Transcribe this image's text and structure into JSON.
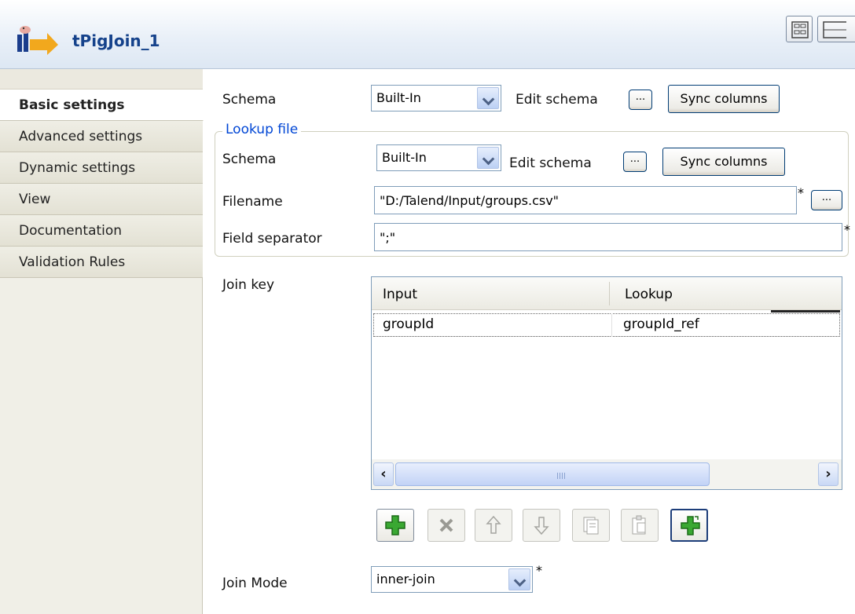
{
  "header": {
    "title": "tPigJoin_1",
    "icon": "pig-join-component-icon",
    "layout_buttons": [
      "grid-layout-icon",
      "list-layout-icon"
    ]
  },
  "sidebar": {
    "items": [
      {
        "label": "Basic settings",
        "active": true
      },
      {
        "label": "Advanced settings",
        "active": false
      },
      {
        "label": "Dynamic settings",
        "active": false
      },
      {
        "label": "View",
        "active": false
      },
      {
        "label": "Documentation",
        "active": false
      },
      {
        "label": "Validation Rules",
        "active": false
      }
    ]
  },
  "form": {
    "schema": {
      "label": "Schema",
      "value": "Built-In",
      "edit_label": "Edit schema",
      "dots": "...",
      "sync_label": "Sync columns"
    },
    "lookup_file": {
      "legend": "Lookup file",
      "schema": {
        "label": "Schema",
        "value": "Built-In",
        "edit_label": "Edit schema",
        "dots": "...",
        "sync_label": "Sync columns"
      },
      "filename": {
        "label": "Filename",
        "value": "\"D:/Talend/Input/groups.csv\"",
        "required": "*",
        "dots": "..."
      },
      "field_separator": {
        "label": "Field separator",
        "value": "\";\"",
        "required": "*"
      }
    },
    "join_key": {
      "label": "Join key",
      "columns": [
        "Input",
        "Lookup"
      ],
      "rows": [
        [
          "groupId",
          "groupId_ref"
        ]
      ]
    },
    "toolbar": [
      "add-icon",
      "remove-icon",
      "move-up-icon",
      "move-down-icon",
      "copy-icon",
      "paste-icon",
      "add-all-icon"
    ],
    "join_mode": {
      "label": "Join Mode",
      "value": "inner-join",
      "required": "*"
    }
  },
  "colors": {
    "title": "#15428b",
    "legend": "#0046d5",
    "sidebar_bg": "#f0efe7",
    "add_green": "#2f9e2a"
  }
}
